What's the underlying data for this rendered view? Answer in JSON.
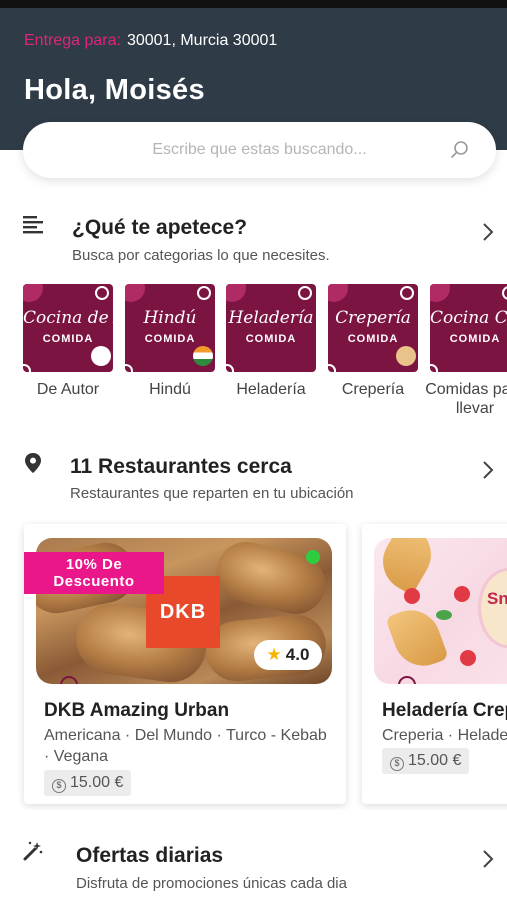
{
  "header": {
    "delivery_label": "Entrega para:",
    "delivery_address": "30001, Murcia 30001",
    "greeting": "Hola, Moisés"
  },
  "search": {
    "placeholder": "Escribe que estas buscando..."
  },
  "categories_section": {
    "title": "¿Qué te apetece?",
    "subtitle": "Busca por categorias lo que necesites.",
    "items": [
      {
        "script": "Cocina de Autor",
        "kind": "COMIDA",
        "label": "De Autor"
      },
      {
        "script": "Hindú",
        "kind": "COMIDA",
        "label": "Hindú"
      },
      {
        "script": "Heladería",
        "kind": "COMIDA",
        "label": "Heladería"
      },
      {
        "script": "Crepería",
        "kind": "COMIDA",
        "label": "Crepería"
      },
      {
        "script": "Cocina Casera",
        "kind": "COMIDA",
        "label": "Comidas para llevar"
      }
    ]
  },
  "restaurants_section": {
    "title": "11 Restaurantes cerca",
    "subtitle": "Restaurantes que reparten en tu ubicación",
    "items": [
      {
        "discount": "10% De Descuento",
        "logo": "DKB",
        "rating": "4.0",
        "name": "DKB Amazing Urban",
        "tags": "Americana · Del Mundo · Turco - Kebab · Vegana",
        "price": "15.00 €"
      },
      {
        "logo": "Snow",
        "name": "Heladería Creps",
        "tags": "Creperia · Heladería",
        "price": "15.00 €"
      }
    ]
  },
  "offers_section": {
    "title": "Ofertas diarias",
    "subtitle": "Disfruta de promociones únicas cada dia"
  },
  "colors": {
    "header_bg": "#2f3b47",
    "accent_pink": "#e0247c",
    "category_tile": "#7c1441",
    "discount_badge": "#e9178a",
    "open_indicator": "#2ecc40"
  },
  "icons": {
    "categories": "list-icon",
    "restaurants": "location-pin-icon",
    "offers": "magic-wand-icon",
    "search": "search-icon",
    "more": "chevron-right-icon"
  }
}
